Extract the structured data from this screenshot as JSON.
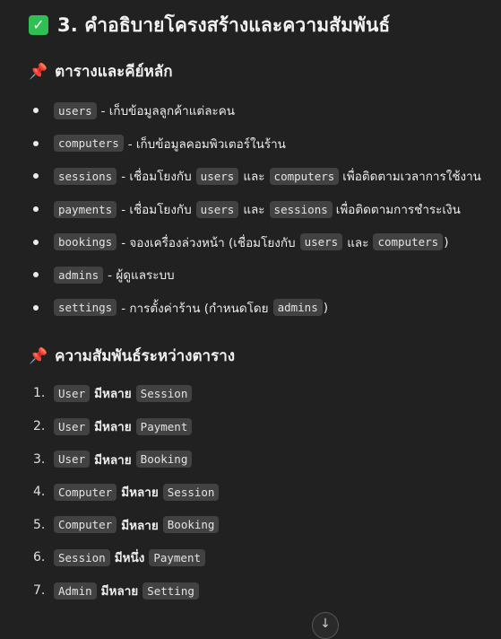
{
  "heading": {
    "icon": "check-mark-button-icon",
    "check_glyph": "✓",
    "title": "3. คำอธิบายโครงสร้างและความสัมพันธ์"
  },
  "tables_section": {
    "icon": "pushpin-icon",
    "pin_glyph": "📌",
    "title": "ตารางและคีย์หลัก",
    "items": [
      {
        "code": "users",
        "text": "- เก็บข้อมูลลูกค้าแต่ละคน"
      },
      {
        "code": "computers",
        "text": "- เก็บข้อมูลคอมพิวเตอร์ในร้าน"
      },
      {
        "code": "sessions",
        "text": "- เชื่อมโยงกับ",
        "code2": "users",
        "mid": "และ",
        "code3": "computers",
        "tail": "เพื่อติดตามเวลาการใช้งาน"
      },
      {
        "code": "payments",
        "text": "- เชื่อมโยงกับ",
        "code2": "users",
        "mid": "และ",
        "code3": "sessions",
        "tail": "เพื่อติดตามการชำระเงิน"
      },
      {
        "code": "bookings",
        "text": "- จองเครื่องล่วงหน้า (เชื่อมโยงกับ",
        "code2": "users",
        "mid": "และ",
        "code3": "computers",
        "tail": ")"
      },
      {
        "code": "admins",
        "text": "- ผู้ดูแลระบบ"
      },
      {
        "code": "settings",
        "text": "- การตั้งค่าร้าน (กำหนดโดย",
        "code2": "admins",
        "tail": ")"
      }
    ]
  },
  "relations_section": {
    "icon": "pushpin-icon",
    "pin_glyph": "📌",
    "title": "ความสัมพันธ์ระหว่างตาราง",
    "items": [
      {
        "num": "1.",
        "left": "User",
        "rel": "มีหลาย",
        "right": "Session"
      },
      {
        "num": "2.",
        "left": "User",
        "rel": "มีหลาย",
        "right": "Payment"
      },
      {
        "num": "3.",
        "left": "User",
        "rel": "มีหลาย",
        "right": "Booking"
      },
      {
        "num": "4.",
        "left": "Computer",
        "rel": "มีหลาย",
        "right": "Session"
      },
      {
        "num": "5.",
        "left": "Computer",
        "rel": "มีหลาย",
        "right": "Booking"
      },
      {
        "num": "6.",
        "left": "Session",
        "rel": "มีหนึ่ง",
        "right": "Payment"
      },
      {
        "num": "7.",
        "left": "Admin",
        "rel": "มีหลาย",
        "right": "Setting"
      }
    ]
  },
  "scroll_button": {
    "icon": "arrow-down-icon",
    "glyph": "↓"
  }
}
